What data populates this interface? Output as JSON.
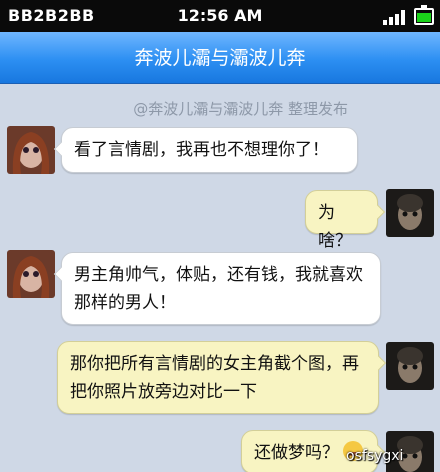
{
  "statusbar": {
    "carrier": "BB2B2BB",
    "time": "12:56 AM"
  },
  "navbar": {
    "title": "奔波儿灞与灞波儿奔"
  },
  "source_line": "@奔波儿灞与灞波儿奔 整理发布",
  "messages": [
    {
      "side": "left",
      "text": "看了言情剧，我再也不想理你了！"
    },
    {
      "side": "right",
      "text": "为啥？"
    },
    {
      "side": "left",
      "text": "男主角帅气，体贴，还有钱，我就喜欢那样的男人！"
    },
    {
      "side": "right",
      "text": "那你把所有言情剧的女主角截个图，再把你照片放旁边对比一下"
    },
    {
      "side": "right",
      "text": "还做梦吗？"
    }
  ],
  "watermark": "osfsygxi",
  "colors": {
    "navbar": "#2c8ff2",
    "bubble_left": "#ffffff",
    "bubble_right": "#f8f4c2",
    "background": "#cfd8e6"
  },
  "icons": {
    "signal": "signal-bars-icon",
    "battery": "battery-icon",
    "emoji": "sweat-smile-emoji-icon"
  }
}
